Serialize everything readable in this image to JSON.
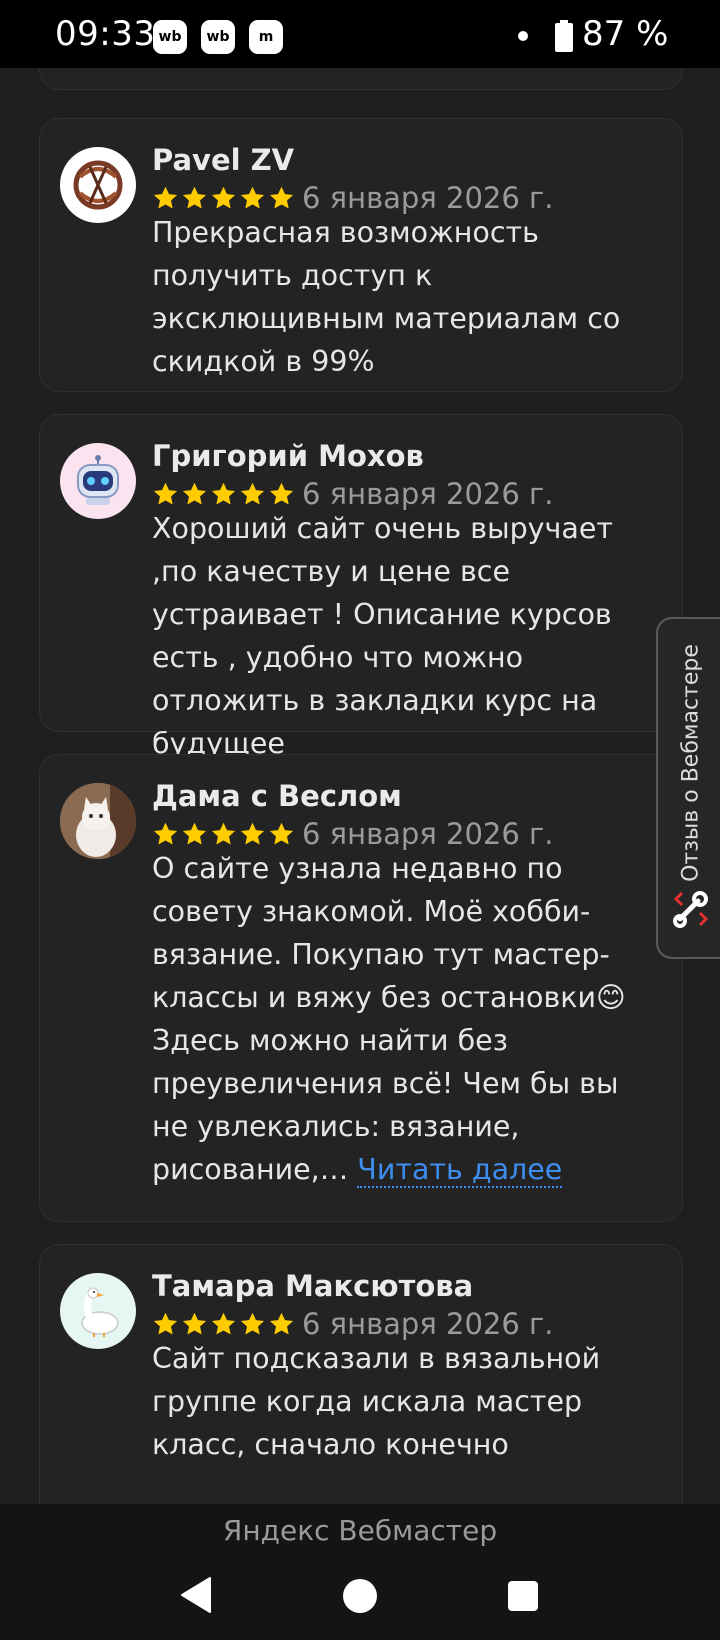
{
  "status_bar": {
    "time": "09:33",
    "apps": [
      "wb",
      "wb",
      "m"
    ],
    "battery": "87 %"
  },
  "reviews": [
    {
      "author": "Pavel ZV",
      "rating": 5,
      "date": "6 января 2026 г.",
      "text": "Прекрасная возможность получить доступ к эксклющивным материалам со скидкой в 99%",
      "avatar": "logo-avatar"
    },
    {
      "author": "Григорий Мохов",
      "rating": 5,
      "date": "6 января 2026 г.",
      "text": "Хороший сайт очень выручает ,по качеству и цене все устраивает ! Описание курсов есть , удобно что можно отложить в закладки курс на будущее",
      "avatar": "robot-avatar"
    },
    {
      "author": "Дама с Веслом",
      "rating": 5,
      "date": "6 января 2026 г.",
      "text": "О сайте узнала недавно по совету знакомой. Моё хобби-вязание. Покупаю тут мастер-классы и вяжу без остановки😊Здесь можно найти без преувеличения всё! Чем бы вы не увлекались: вязание, рисование,…",
      "more_link": "Читать далее",
      "avatar": "cat-avatar"
    },
    {
      "author": "Тамара Максютова",
      "rating": 5,
      "date": "6 января 2026 г.",
      "text": "Сайт подсказали в вязальной группе когда искала мастер класс, сначало конечно",
      "avatar": "goose-avatar"
    }
  ],
  "side_tab": {
    "label": "Отзыв о Вебмастере",
    "icon": "wrench-icon"
  },
  "footer": {
    "title": "Яндекс Вебмастер"
  },
  "colors": {
    "background": "#1f1f1f",
    "card": "#232323",
    "star": "#ffcc00",
    "link": "#3d8ef0"
  }
}
